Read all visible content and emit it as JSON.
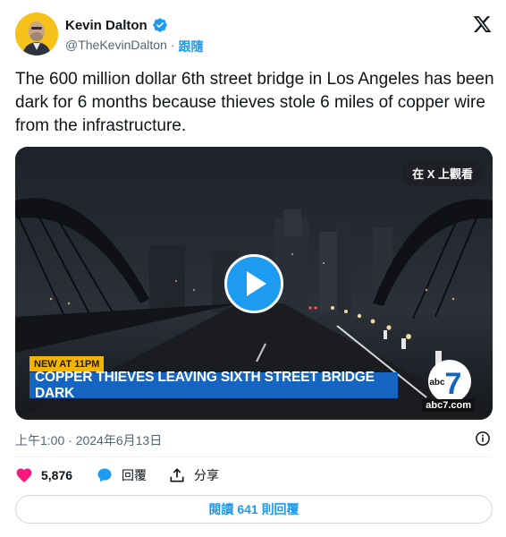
{
  "author": {
    "name": "Kevin Dalton",
    "handle": "@TheKevinDalton",
    "separator": "·",
    "follow_label": "跟隨",
    "verified_icon": "verified-badge-icon",
    "avatar_color": "#f6c21a"
  },
  "tweet": {
    "text": "The 600 million dollar 6th street bridge in Los Angeles has been dark for 6 months because thieves stole 6 miles of copper wire from the infrastructure."
  },
  "media": {
    "watch_on_x": "在 X 上觀看",
    "play_icon": "play-icon",
    "lower_third_tag": "NEW AT 11PM",
    "headline": "COPPER THIEVES LEAVING SIXTH STREET BRIDGE DARK",
    "logo_text": "abc",
    "logo_number": "7",
    "url": "abc7.com",
    "headline_color": "#1565c0",
    "tag_color": "#f4b400"
  },
  "meta": {
    "timestamp": "上午1:00 · 2024年6月13日"
  },
  "actions": {
    "likes": "5,876",
    "reply_label": "回覆",
    "share_label": "分享",
    "like_color": "#f91880",
    "reply_color": "#1d9bf0"
  },
  "read_replies": {
    "prefix": "閱讀",
    "count": "641",
    "suffix": "則回覆"
  }
}
